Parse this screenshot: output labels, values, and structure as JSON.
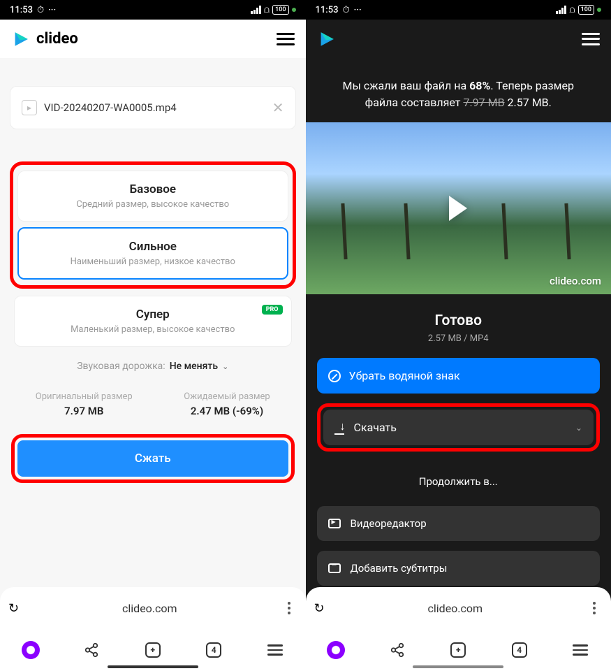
{
  "status": {
    "time": "11:53",
    "battery": "100"
  },
  "brand": "clideo",
  "left": {
    "file_name": "VID-20240207-WA0005.mp4",
    "options": {
      "basic": {
        "title": "Базовое",
        "desc": "Средний размер, высокое качество"
      },
      "strong": {
        "title": "Сильное",
        "desc": "Наименьший размер, низкое качество"
      },
      "super": {
        "title": "Супер",
        "desc": "Маленький размер, высокое качество",
        "badge": "PRO"
      }
    },
    "audio": {
      "label": "Звуковая дорожка:",
      "value": "Не менять"
    },
    "original": {
      "label": "Оригинальный размер",
      "value": "7.97 MB"
    },
    "expected": {
      "label": "Ожидаемый размер",
      "value": "2.47 MB (-69%)"
    },
    "compress_btn": "Сжать"
  },
  "right": {
    "msg_prefix": "Мы сжали ваш файл на ",
    "msg_percent": "68%",
    "msg_mid": ". Теперь размер файла составляет ",
    "old_size": "7.97 MB",
    "new_size": " 2.57 MB.",
    "watermark": "clideo.com",
    "done": "Готово",
    "done_meta": "2.57 MB  /  MP4",
    "remove_watermark": "Убрать водяной знак",
    "download": "Скачать",
    "continue": "Продолжить в...",
    "editor": "Видеоредактор",
    "subtitles": "Добавить субтитры"
  },
  "browser": {
    "url": "clideo.com",
    "tabs": "4"
  }
}
